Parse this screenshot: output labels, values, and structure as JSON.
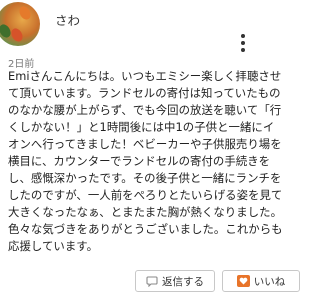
{
  "comment": {
    "username": "さわ",
    "timestamp": "2日前",
    "body": "Emiさんこんにちは。いつもエミシー楽しく拝聴させて頂いています。ランドセルの寄付は知っていたもののなかな腰が上がらず、でも今回の放送を聴いて「行くしかない！」と1時間後には中1の子供と一緒にイオンへ行ってきました！ベビーカーや子供服売り場を横目に、カウンターでランドセルの寄付の手続きをし、感慨深かったです。その後子供と一緒にランチをしたのですが、一人前をぺろりとたいらげる姿を見て大きくなったなぁ、とまたまた胸が熱くなりました。色々な気づきをありがとうございました。これからも応援しています。"
  },
  "actions": {
    "reply_label": "返信する",
    "like_label": "いいね",
    "colors": {
      "heart": "#e8742a",
      "icon": "#888888"
    }
  }
}
